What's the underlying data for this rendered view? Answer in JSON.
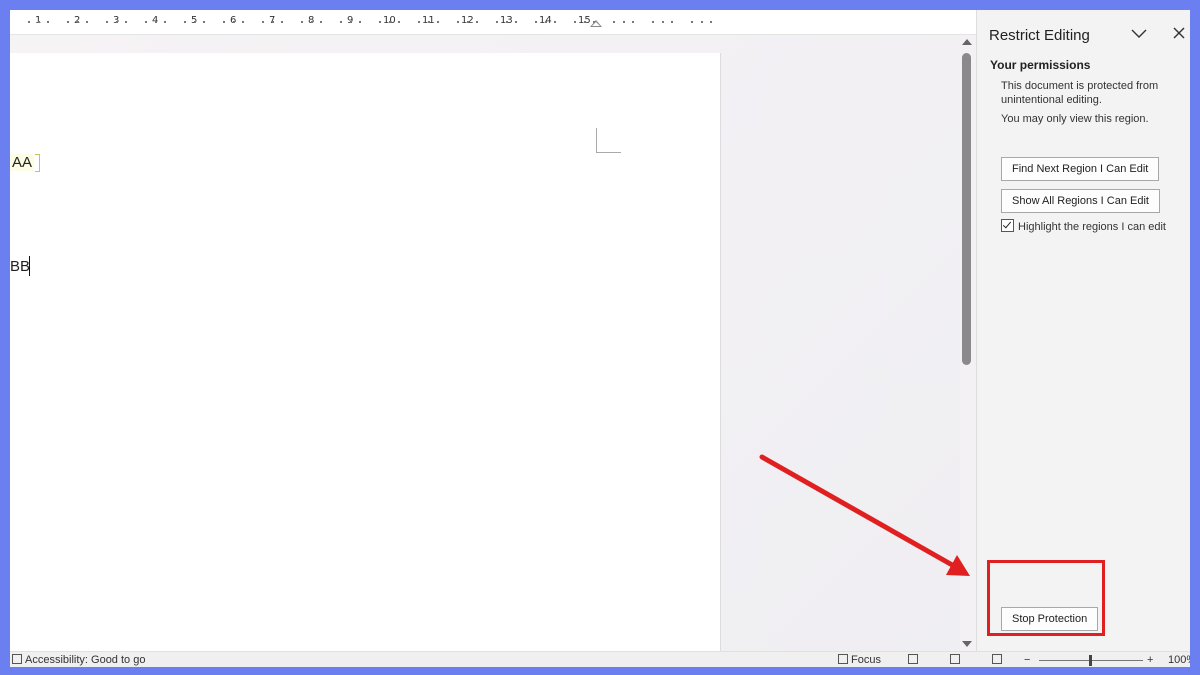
{
  "ruler": {
    "labels": [
      "1",
      "2",
      "3",
      "4",
      "5",
      "6",
      "7",
      "8",
      "9",
      "10",
      "11",
      "12",
      "13",
      "14",
      "15"
    ]
  },
  "document": {
    "line1": "AA",
    "line2": "BB"
  },
  "pane": {
    "title": "Restrict Editing",
    "collapse_icon": "chevron-down-icon",
    "close_icon": "close-icon",
    "heading": "Your permissions",
    "text1": "This document is protected from unintentional editing.",
    "text2": "You may only view this region.",
    "find_next_button": "Find Next Region I Can Edit",
    "show_all_button": "Show All Regions I Can Edit",
    "highlight_checkbox_label": "Highlight the regions I can edit",
    "highlight_checked": true,
    "stop_protection_button": "Stop Protection"
  },
  "annotation": {
    "color": "#e02020"
  },
  "statusbar": {
    "accessibility": "Accessibility: Good to go",
    "focus": "Focus",
    "zoom_minus": "−",
    "zoom_plus": "+",
    "zoom": "100%"
  }
}
